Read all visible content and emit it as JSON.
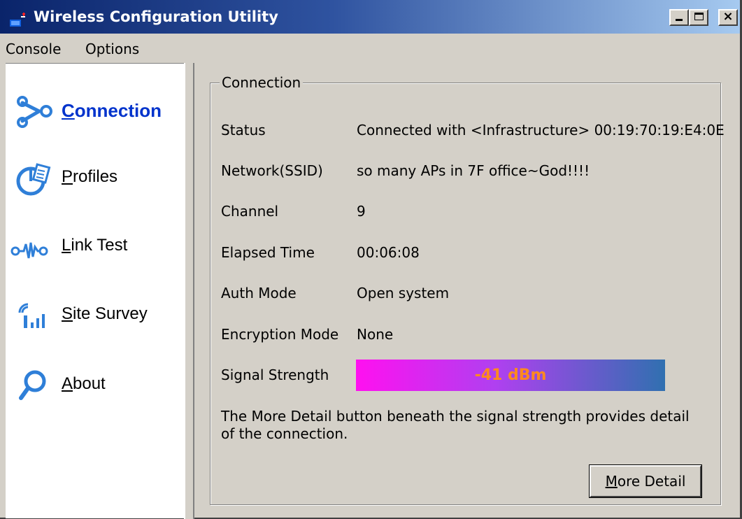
{
  "window": {
    "title": "Wireless Configuration Utility",
    "controls": {
      "minimize": "_",
      "maximize": "□",
      "close": "×"
    }
  },
  "menu": {
    "items": [
      {
        "label": "Console"
      },
      {
        "label": "Options"
      }
    ]
  },
  "sidebar": {
    "items": [
      {
        "label": "Connection",
        "accel": "C",
        "rest": "onnection",
        "icon": "connection-icon",
        "active": true
      },
      {
        "label": "Profiles",
        "accel": "P",
        "rest": "rofiles",
        "icon": "profiles-icon"
      },
      {
        "label": "Link Test",
        "accel": "L",
        "rest": "ink Test",
        "icon": "link-test-icon"
      },
      {
        "label": "Site Survey",
        "accel": "S",
        "rest": "ite Survey",
        "icon": "site-survey-icon"
      },
      {
        "label": "About",
        "accel": "A",
        "rest": "bout",
        "icon": "about-icon"
      }
    ]
  },
  "connection": {
    "group_title": "Connection",
    "rows": [
      {
        "label": "Status",
        "value": "Connected with <Infrastructure> 00:19:70:19:E4:0E"
      },
      {
        "label": "Network(SSID)",
        "value": "so many APs in 7F office~God!!!!"
      },
      {
        "label": "Channel",
        "value": "9"
      },
      {
        "label": "Elapsed Time",
        "value": "00:06:08"
      },
      {
        "label": "Auth Mode",
        "value": "Open system"
      },
      {
        "label": "Encryption Mode",
        "value": "None"
      }
    ],
    "signal": {
      "label": "Signal Strength",
      "value": "-41 dBm"
    },
    "note": "The More Detail button beneath the signal strength provides detail of the connection.",
    "more_detail": {
      "label": "More Detail",
      "accel": "M",
      "rest": "ore Detail"
    }
  },
  "colors": {
    "title_gradient_start": "#0a246a",
    "title_gradient_end": "#a6caf0",
    "active_nav": "#0033cc",
    "signal_start": "#ff10f0",
    "signal_end": "#3070b0",
    "signal_text": "#ff8a1e",
    "face": "#d4d0c8"
  }
}
